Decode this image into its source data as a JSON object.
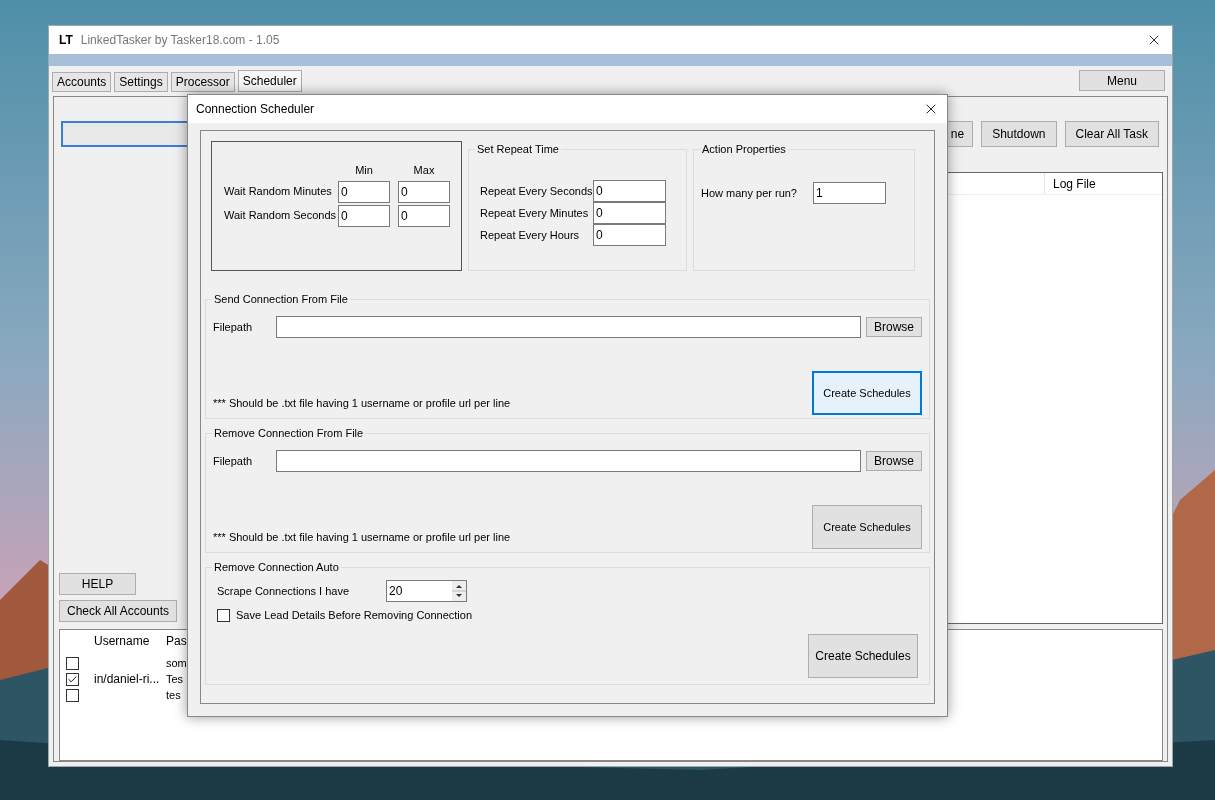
{
  "window": {
    "logo": "LT",
    "title": "LinkedTasker by Tasker18.com - 1.05"
  },
  "tabs": [
    {
      "label": "Accounts",
      "selected": false
    },
    {
      "label": "Settings",
      "selected": false
    },
    {
      "label": "Processor",
      "selected": false
    },
    {
      "label": "Scheduler",
      "selected": true
    }
  ],
  "menu_button": "Menu",
  "toolbar_buttons": [
    "ne",
    "Shutdown",
    "Clear All Task"
  ],
  "log_table": {
    "columns": [
      "Log File"
    ]
  },
  "help_button": "HELP",
  "check_accounts_button": "Check All Accounts",
  "accounts_table": {
    "columns": [
      "Username",
      "Pas"
    ],
    "rows": [
      {
        "checked": false,
        "column_2": "som"
      },
      {
        "checked": true,
        "username": "in/daniel-ri...",
        "column_2": "Tes"
      },
      {
        "checked": false,
        "column_2": "tes"
      }
    ]
  },
  "dialog": {
    "title": "Connection Scheduler",
    "wait": {
      "columns": [
        "Min",
        "Max"
      ],
      "rows": [
        {
          "label": "Wait Random Minutes",
          "min": "0",
          "max": "0"
        },
        {
          "label": "Wait Random Seconds",
          "min": "0",
          "max": "0"
        }
      ]
    },
    "repeat": {
      "title": "Set Repeat Time",
      "rows": [
        {
          "label": "Repeat Every Seconds",
          "value": "0"
        },
        {
          "label": "Repeat Every Minutes",
          "value": "0"
        },
        {
          "label": "Repeat Every Hours",
          "value": "0"
        }
      ]
    },
    "action": {
      "title": "Action Properties",
      "label": "How many per run?",
      "value": "1"
    },
    "file_groups": [
      {
        "title": "Send Connection From File",
        "filepath_label": "Filepath",
        "browse": "Browse",
        "note": "*** Should be .txt file having 1 username or profile url per line",
        "button": "Create Schedules",
        "focused": true
      },
      {
        "title": "Remove Connection From File",
        "filepath_label": "Filepath",
        "browse": "Browse",
        "note": "*** Should be .txt file having 1 username or profile url per line",
        "button": "Create Schedules",
        "focused": false
      }
    ],
    "auto": {
      "title": "Remove Connection Auto",
      "scrape_label": "Scrape Connections I have",
      "scrape_value": "20",
      "checkbox": {
        "label": "Save Lead Details Before Removing Connection",
        "checked": false
      },
      "button": "Create Schedules"
    }
  }
}
